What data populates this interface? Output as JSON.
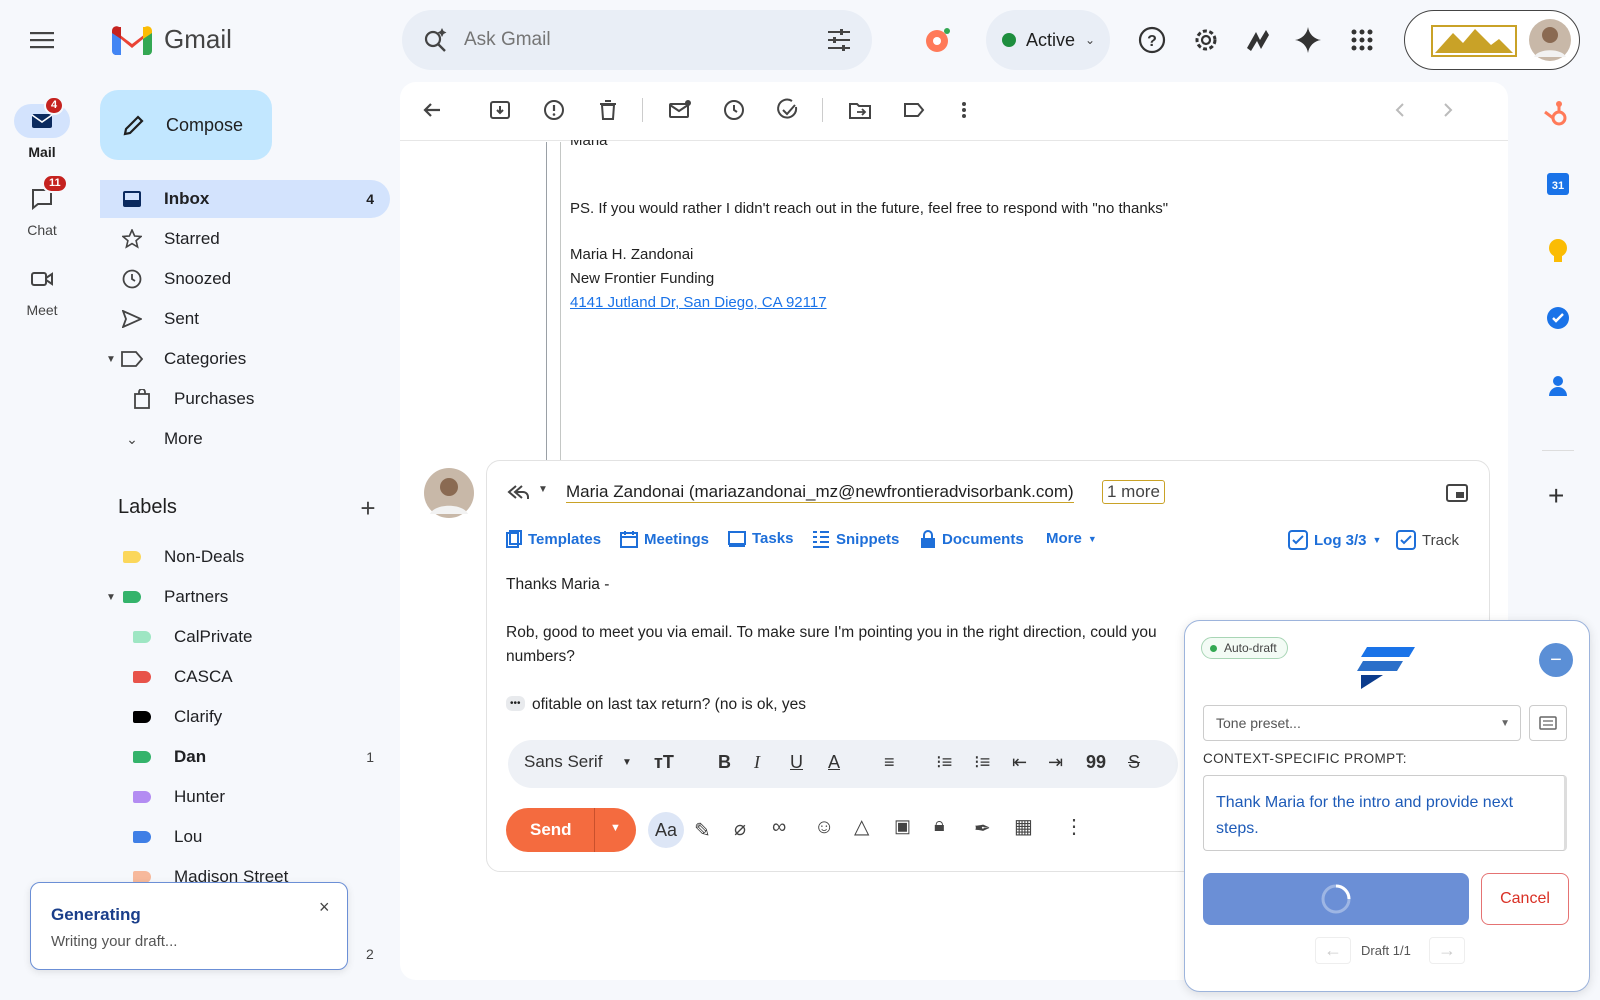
{
  "app": {
    "name": "Gmail"
  },
  "search": {
    "placeholder": "Ask Gmail"
  },
  "status": {
    "label": "Active",
    "color": "#188038"
  },
  "rail": {
    "mail": {
      "label": "Mail",
      "badge": "4"
    },
    "chat": {
      "label": "Chat",
      "badge": "11"
    },
    "meet": {
      "label": "Meet"
    }
  },
  "compose_label": "Compose",
  "nav": {
    "inbox": {
      "label": "Inbox",
      "count": "4"
    },
    "starred": "Starred",
    "snoozed": "Snoozed",
    "sent": "Sent",
    "categories": "Categories",
    "purchases": "Purchases",
    "more": "More"
  },
  "labels": {
    "title": "Labels",
    "items": [
      {
        "name": "Non-Deals",
        "color": "#fbd75b",
        "count": ""
      },
      {
        "name": "Partners",
        "color": "#34b36b",
        "count": ""
      },
      {
        "name": "CalPrivate",
        "color": "#9ee6c3",
        "count": ""
      },
      {
        "name": "CASCA",
        "color": "#e8534a",
        "count": ""
      },
      {
        "name": "Clarify",
        "color": "#000000",
        "count": ""
      },
      {
        "name": "Dan",
        "color": "#34b36b",
        "count": "1"
      },
      {
        "name": "Hunter",
        "color": "#b38cf2",
        "count": ""
      },
      {
        "name": "Lou",
        "color": "#3f7fe6",
        "count": ""
      },
      {
        "name": "Madison Street",
        "color": "#f7b99c",
        "count": ""
      }
    ],
    "bottom_count": "2"
  },
  "message": {
    "cut_name": "Maria",
    "ps": "PS. If you would rather I didn't reach out in the future, feel free to respond with \"no thanks\"",
    "sig_name": "Maria H. Zandonai",
    "sig_company": "New Frontier Funding",
    "sig_address": "4141 Jutland Dr, San Diego, CA 92117"
  },
  "reply": {
    "to": "Maria Zandonai (mariazandonai_mz@newfrontieradvisorbank.com)",
    "more": "1 more",
    "tabs": [
      "Templates",
      "Meetings",
      "Tasks",
      "Snippets",
      "Documents",
      "More"
    ],
    "log": "Log 3/3",
    "track": "Track",
    "body_line1": "Thanks Maria -",
    "body_line2": "Rob, good to meet you via email. To make sure I'm pointing you in the right direction, could you",
    "body_line3": "numbers?",
    "body_line4": "ofitable on last tax return? (no is ok, yes",
    "font": "Sans Serif",
    "send": "Send"
  },
  "autodraft": {
    "badge": "Auto-draft",
    "tone_placeholder": "Tone preset...",
    "prompt_label": "CONTEXT-SPECIFIC PROMPT:",
    "prompt_text": "Thank Maria for the intro and provide next steps.",
    "cancel": "Cancel",
    "pager": "Draft 1/1"
  },
  "toast": {
    "title": "Generating",
    "body": "Writing your draft..."
  }
}
